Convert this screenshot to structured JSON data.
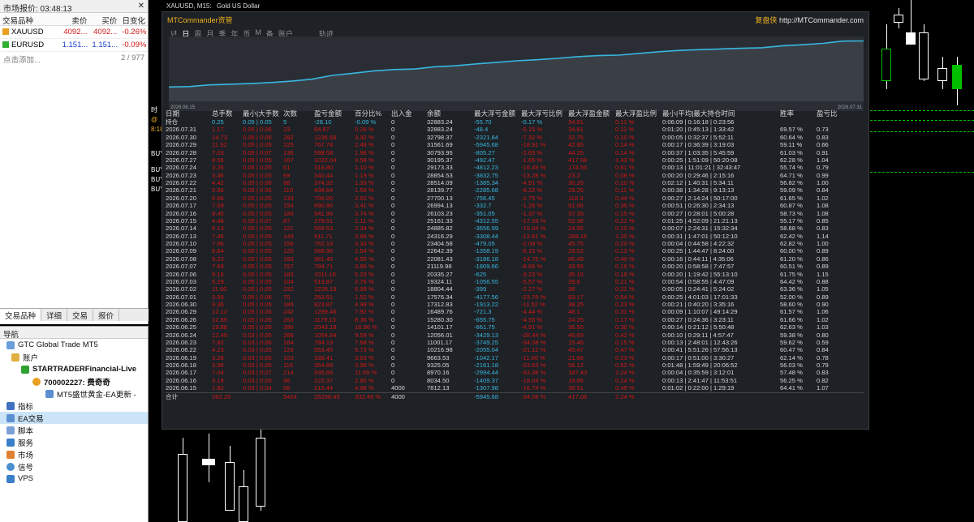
{
  "market_watch": {
    "title": "市场报价: 03:48:13",
    "headers": [
      "交易品种",
      "卖价",
      "买价",
      "日变化"
    ],
    "rows": [
      {
        "symbol": "XAUUSD",
        "bid": "4092...",
        "ask": "4092...",
        "change": "-0.26%"
      },
      {
        "symbol": "EURUSD",
        "bid": "1.151...",
        "ask": "1.151...",
        "change": "-0.09%"
      }
    ],
    "add_label": "点击添加...",
    "count": "2 / 977",
    "tabs": [
      "交易品种",
      "详细",
      "交易",
      "报价"
    ]
  },
  "navigator": {
    "title": "导航",
    "items": [
      "GTC Global Trade MT5",
      "账户",
      "STARTRADERFinancial-Live",
      "700002227: 费奇奇",
      "MT5盛世黄金-EA更新 -",
      "指标",
      "EA交易",
      "脚本",
      "服务",
      "市场",
      "信号",
      "VPS"
    ]
  },
  "chart_bar": {
    "symbol": "XAUUSD, M15:",
    "desc": "Gold US Dollar"
  },
  "mtc": {
    "title": "MTCommander资管",
    "brand": "复盘侠",
    "url": "http://MTCommander.com",
    "tabs": [
      "년",
      "日",
      "周",
      "月",
      "季",
      "年",
      "币",
      "M",
      "备",
      "账户",
      "轨迹"
    ],
    "chart_start": "2026.06.15",
    "chart_end": "2026.07.31",
    "accent": "#38b6e0"
  },
  "table": {
    "headers": [
      "日期",
      "总手数",
      "最小|大手数",
      "次数",
      "盈亏金额",
      "百分比%",
      "出入金",
      "余额",
      "最大浮亏金额",
      "最大浮亏比例",
      "最大浮盈金额",
      "最大浮盈比例",
      "最小|平均|最大持仓时间",
      "胜率",
      "盈亏比"
    ],
    "hold": [
      "持仓",
      "0.25",
      "0.05 | 0.05",
      "5",
      "-28.10",
      "-0.09 %",
      "0",
      "32883.24",
      "-55.70",
      "-0.17 %",
      "34.81",
      "0.11 %",
      "0:06:09 | 0:16:18 | 0:23:56",
      "",
      ""
    ],
    "rows": [
      [
        "2026.07.31",
        "1.17",
        "0.05 | 0.06",
        "23",
        "84.87",
        "0.26 %",
        "0",
        "32883.24",
        "-48.4",
        "-0.15 %",
        "34.81",
        "0.11 %",
        "0:01:20 | 0:45:13 | 1:33:42",
        "69.57 %",
        "0.73"
      ],
      [
        "2026.07.30",
        "14.73",
        "0.05 | 0.06",
        "282",
        "1236.68",
        "3.92 %",
        "0",
        "32798.37",
        "-2321.84",
        "-7.32 %",
        "32.75",
        "0.10 %",
        "0:00:05 | 0:32:37 | 5:52:11",
        "60.64 %",
        "0.83"
      ],
      [
        "2026.07.29",
        "11.92",
        "0.05 | 0.05",
        "225",
        "767.74",
        "2.49 %",
        "0",
        "31561.69",
        "-5945.68",
        "-18.91 %",
        "42.85",
        "0.14 %",
        "0:00:17 | 0:36:39 | 3:19:03",
        "59.11 %",
        "0.66"
      ],
      [
        "2026.07.28",
        "7.03",
        "0.05 | 0.07",
        "136",
        "598.58",
        "1.98 %",
        "0",
        "30793.95",
        "-805.27",
        "-2.65 %",
        "44.25",
        "0.14 %",
        "0:00:37 | 1:03:35 | 5:45:59",
        "61.03 %",
        "0.91"
      ],
      [
        "2026.07.27",
        "8.56",
        "0.05 | 0.05",
        "167",
        "1022.04",
        "3.58 %",
        "0",
        "30195.37",
        "-492.47",
        "-1.65 %",
        "417.08",
        "1.43 %",
        "0:00:25 | 1:51:09 | 50:20:08",
        "62.28 %",
        "1.04"
      ],
      [
        "2026.07.24",
        "3.26",
        "0.05 | 0.05",
        "61",
        "318.80",
        "1.10 %",
        "0",
        "29173.33",
        "-4812.23",
        "-16.49 %",
        "174.56",
        "0.61 %",
        "0:00:13 | 11:01:21 | 32:43:47",
        "55.74 %",
        "0.79"
      ],
      [
        "2026.07.23",
        "3.46",
        "0.05 | 0.05",
        "69",
        "340.44",
        "1.19 %",
        "0",
        "28854.53",
        "-3832.75",
        "-13.28 %",
        "23.2",
        "0.08 %",
        "0:00:20 | 0:29:46 | 2:15:16",
        "64.71 %",
        "0.99"
      ],
      [
        "2026.07.22",
        "4.42",
        "0.05 | 0.06",
        "88",
        "374.32",
        "1.33 %",
        "0",
        "28514.09",
        "-1385.34",
        "-4.91 %",
        "30.26",
        "0.10 %",
        "0:02:12 | 1:40:31 | 5:34:11",
        "56.82 %",
        "1.00"
      ],
      [
        "2026.07.21",
        "5.56",
        "0.05 | 0.06",
        "110",
        "438.64",
        "1.59 %",
        "0",
        "28139.77",
        "-2285.68",
        "-8.22 %",
        "29.25",
        "0.11 %",
        "0:00:38 | 1:34:28 | 9:13:13",
        "59.09 %",
        "0.84"
      ],
      [
        "2026.07.20",
        "6.66",
        "0.05 | 0.05",
        "133",
        "706.00",
        "2.62 %",
        "0",
        "27700.13",
        "-756.45",
        "-2.75 %",
        "118.3",
        "0.44 %",
        "0:00:27 | 2:14:24 | 50:17:00",
        "61.65 %",
        "1.02"
      ],
      [
        "2026.07.17",
        "7.69",
        "0.05 | 0.05",
        "154",
        "890.90",
        "3.41 %",
        "0",
        "26994.13",
        "-332.7",
        "-1.26 %",
        "91.06",
        "0.35 %",
        "0:00:51 | 0:26:30 | 2:34:13",
        "60.87 %",
        "1.08"
      ],
      [
        "2026.07.16",
        "9.45",
        "0.05 | 0.05",
        "189",
        "941.96",
        "3.74 %",
        "0",
        "26103.23",
        "-351.05",
        "-1.37 %",
        "37.35",
        "0.15 %",
        "0:00:27 | 0:28:01 | 5:00:28",
        "58.73 %",
        "1.08"
      ],
      [
        "2026.07.15",
        "4.48",
        "0.05 | 0.07",
        "87",
        "278.51",
        "1.11 %",
        "0",
        "25161.33",
        "-4312.55",
        "-17.33 %",
        "52.36",
        "0.21 %",
        "0:01:25 | 4:52:09 | 21:21:13",
        "55.17 %",
        "0.85"
      ],
      [
        "2026.07.14",
        "6.13",
        "0.05 | 0.05",
        "121",
        "569.53",
        "2.34 %",
        "0",
        "24885.82",
        "-3656.99",
        "-15.04 %",
        "24.55",
        "0.10 %",
        "0:00:07 | 2:24:31 | 15:32:34",
        "58.68 %",
        "0.83"
      ],
      [
        "2026.07.13",
        "7.45",
        "0.05 | 0.05",
        "149",
        "911.71",
        "3.89 %",
        "0",
        "24316.29",
        "-3308.44",
        "-13.61 %",
        "288.16",
        "1.20 %",
        "0:00:31 | 1:47:01 | 50:12:10",
        "62.42 %",
        "1.14"
      ],
      [
        "2026.07.10",
        "7.86",
        "0.05 | 0.05",
        "156",
        "762.19",
        "3.33 %",
        "0",
        "23404.58",
        "-479.05",
        "-2.09 %",
        "45.75",
        "0.20 %",
        "0:00:04 | 0:44:58 | 4:22:32",
        "62.82 %",
        "1.00"
      ],
      [
        "2026.07.09",
        "6.64",
        "0.05 | 0.05",
        "120",
        "568.96",
        "2.54 %",
        "0",
        "22642.39",
        "-1358.19",
        "-6.15 %",
        "29.02",
        "0.13 %",
        "0:00:25 | 1:44:47 | 8:24:00",
        "60.00 %",
        "0.89"
      ],
      [
        "2026.07.08",
        "9.23",
        "0.05 | 0.05",
        "183",
        "961.45",
        "4.55 %",
        "0",
        "22081.43",
        "-3186.18",
        "-14.75 %",
        "86.49",
        "0.40 %",
        "0:00:16 | 0:44:11 | 4:35:06",
        "61.20 %",
        "0.86"
      ],
      [
        "2026.07.07",
        "7.69",
        "0.05 | 0.05",
        "157",
        "784.71",
        "3.86 %",
        "0",
        "21119.98",
        "-1809.66",
        "-8.66 %",
        "33.55",
        "0.16 %",
        "0:00:20 | 0:58:58 | 7:47:57",
        "60.51 %",
        "0.89"
      ],
      [
        "2026.07.06",
        "9.15",
        "0.05 | 0.05",
        "183",
        "1011.16",
        "5.23 %",
        "0",
        "20335.27",
        "-625",
        "-3.23 %",
        "35.15",
        "0.18 %",
        "0:00:20 | 1:19:42 | 55:13:10",
        "61.75 %",
        "1.15"
      ],
      [
        "2026.07.03",
        "5.29",
        "0.05 | 0.05",
        "104",
        "519.87",
        "2.76 %",
        "0",
        "19324.11",
        "-1056.55",
        "-5.57 %",
        "39.6",
        "0.21 %",
        "0:00:54 | 0:58:55 | 4:47:09",
        "64.42 %",
        "0.88"
      ],
      [
        "2026.07.02",
        "11.60",
        "0.05 | 0.05",
        "232",
        "1228.19",
        "6.99 %",
        "0",
        "18804.44",
        "-399",
        "-2.27 %",
        "36",
        "0.21 %",
        "0:00:05 | 0:24:41 | 5:24:02",
        "63.36 %",
        "1.05"
      ],
      [
        "2026.07.01",
        "3.59",
        "0.05 | 0.06",
        "70",
        "263.51",
        "1.52 %",
        "0",
        "17576.34",
        "-4177.56",
        "-23.76 %",
        "93.17",
        "0.54 %",
        "0:00:25 | 4:01:03 | 17:01:33",
        "52.00 %",
        "0.89"
      ],
      [
        "2026.06.30",
        "9.36",
        "0.05 | 0.05",
        "186",
        "823.87",
        "4.99 %",
        "0",
        "17312.83",
        "-1913.22",
        "-11.52 %",
        "38.25",
        "0.23 %",
        "0:00:21 | 0:40:20 | 3:35:16",
        "58.60 %",
        "0.90"
      ],
      [
        "2026.06.29",
        "12.12",
        "0.05 | 0.06",
        "242",
        "1289.46",
        "7.92 %",
        "0",
        "16489.76",
        "-721.3",
        "-4.44 %",
        "48.1",
        "0.31 %",
        "0:00:09 | 1:10:07 | 49:14:29",
        "61.57 %",
        "1.06"
      ],
      [
        "2026.06.26",
        "12.65",
        "0.05 | 0.05",
        "253",
        "1179.13",
        "8.36 %",
        "0",
        "15280.30",
        "-655.75",
        "-4.55 %",
        "24.25",
        "0.17 %",
        "0:00:27 | 0:24:36 | 3:23:11",
        "61.66 %",
        "1.02"
      ],
      [
        "2026.06.25",
        "19.88",
        "0.05 | 0.05",
        "396",
        "2043.18",
        "16.96 %",
        "0",
        "14101.17",
        "-661.75",
        "-4.91 %",
        "36.55",
        "0.30 %",
        "0:00:14 | 0:21:12 | 5:50:48",
        "62.63 %",
        "1.03"
      ],
      [
        "2026.06.24",
        "12.49",
        "0.03 | 0.05",
        "288",
        "1054.84",
        "9.59 %",
        "0",
        "12056.01",
        "-3429.13",
        "-28.44 %",
        "46.69",
        "0.42 %",
        "0:00:10 | 0:29:11 | 4:57:47",
        "59.38 %",
        "0.80"
      ],
      [
        "2026.06.23",
        "7.82",
        "0.03 | 0.06",
        "164",
        "784.19",
        "7.68 %",
        "0",
        "11001.17",
        "-3749.25",
        "-34.08 %",
        "15.46",
        "0.15 %",
        "0:00:13 | 2:48:01 | 12:43:26",
        "59.62 %",
        "0.59"
      ],
      [
        "2026.06.22",
        "4.23",
        "0.03 | 0.05",
        "129",
        "553.45",
        "5.73 %",
        "0",
        "10216.98",
        "-2055.04",
        "-21.12 %",
        "45.47",
        "0.47 %",
        "0:00:41 | 5:51:26 | 57:56:13",
        "60.47 %",
        "0.84"
      ],
      [
        "2026.06.19",
        "3.28",
        "0.03 | 0.05",
        "103",
        "338.41",
        "3.63 %",
        "0",
        "9663.53",
        "-1042.17",
        "-11.06 %",
        "21.66",
        "0.23 %",
        "0:00:17 | 0:51:00 | 3:30:27",
        "62.14 %",
        "0.78"
      ],
      [
        "2026.06.18",
        "3.96",
        "0.03 | 0.06",
        "116",
        "354.89",
        "3.96 %",
        "0",
        "9325.05",
        "-2161.18",
        "-23.63 %",
        "56.12",
        "0.62 %",
        "0:01:48 | 1:59:49 | 20:06:52",
        "56.03 %",
        "0.79"
      ],
      [
        "2026.06.17",
        "7.04",
        "0.03 | 0.07",
        "214",
        "935.66",
        "11.65 %",
        "0",
        "8970.16",
        "-2994.44",
        "-33.38 %",
        "187.43",
        "2.24 %",
        "0:00:04 | 0:35:59 | 3:12:01",
        "57.48 %",
        "0.83"
      ],
      [
        "2026.06.16",
        "3.19",
        "0.03 | 0.05",
        "96",
        "222.37",
        "2.85 %",
        "0",
        "8034.50",
        "-1409.37",
        "-18.04 %",
        "19.66",
        "0.24 %",
        "0:00:13 | 2:41:47 | 11:53:51",
        "56.25 %",
        "0.82"
      ],
      [
        "2026.06.15",
        "1.82",
        "0.03 | 0.04",
        "56",
        "215.44",
        "4.98 %",
        "4000",
        "7812.13",
        "-1307.98",
        "-16.74 %",
        "38.51",
        "0.49 %",
        "0:01:02 | 0:22:00 | 1:29:19",
        "64.41 %",
        "1.07"
      ]
    ],
    "total": [
      "合计",
      "262.29",
      "",
      "5424",
      "25258.45",
      "332.49 %",
      "4000",
      "",
      "-5945.68",
      "-34.08 %",
      "417.08",
      "2.24 %",
      "",
      "",
      ""
    ]
  },
  "chart_data": {
    "type": "line",
    "x": [
      "2026.06.15",
      "2026.06.16",
      "2026.06.17",
      "2026.06.18",
      "2026.06.19",
      "2026.06.22",
      "2026.06.23",
      "2026.06.24",
      "2026.06.25",
      "2026.06.26",
      "2026.06.29",
      "2026.06.30",
      "2026.07.01",
      "2026.07.02",
      "2026.07.03",
      "2026.07.06",
      "2026.07.07",
      "2026.07.08",
      "2026.07.09",
      "2026.07.10",
      "2026.07.13",
      "2026.07.14",
      "2026.07.15",
      "2026.07.16",
      "2026.07.17",
      "2026.07.20",
      "2026.07.21",
      "2026.07.22",
      "2026.07.23",
      "2026.07.24",
      "2026.07.27",
      "2026.07.28",
      "2026.07.29",
      "2026.07.30",
      "2026.07.31"
    ],
    "series": [
      {
        "values": [
          7812.13,
          8034.5,
          8970.16,
          9325.05,
          9663.53,
          10216.98,
          11001.17,
          12056.01,
          14101.17,
          15280.3,
          16489.76,
          17312.83,
          17576.34,
          18804.44,
          19324.11,
          20335.27,
          21119.98,
          22081.43,
          22642.39,
          23404.58,
          24316.29,
          24885.82,
          25161.33,
          26103.23,
          26994.13,
          27700.13,
          28139.77,
          28514.09,
          28854.53,
          29173.33,
          30195.37,
          30793.95,
          31561.69,
          32798.37,
          32883.24
        ]
      }
    ],
    "color": "#38b6e0",
    "grid": false
  },
  "left_labels": [
    "时",
    "@",
    "8:18",
    "BUY",
    "BUY",
    "BUY",
    "BUY"
  ]
}
